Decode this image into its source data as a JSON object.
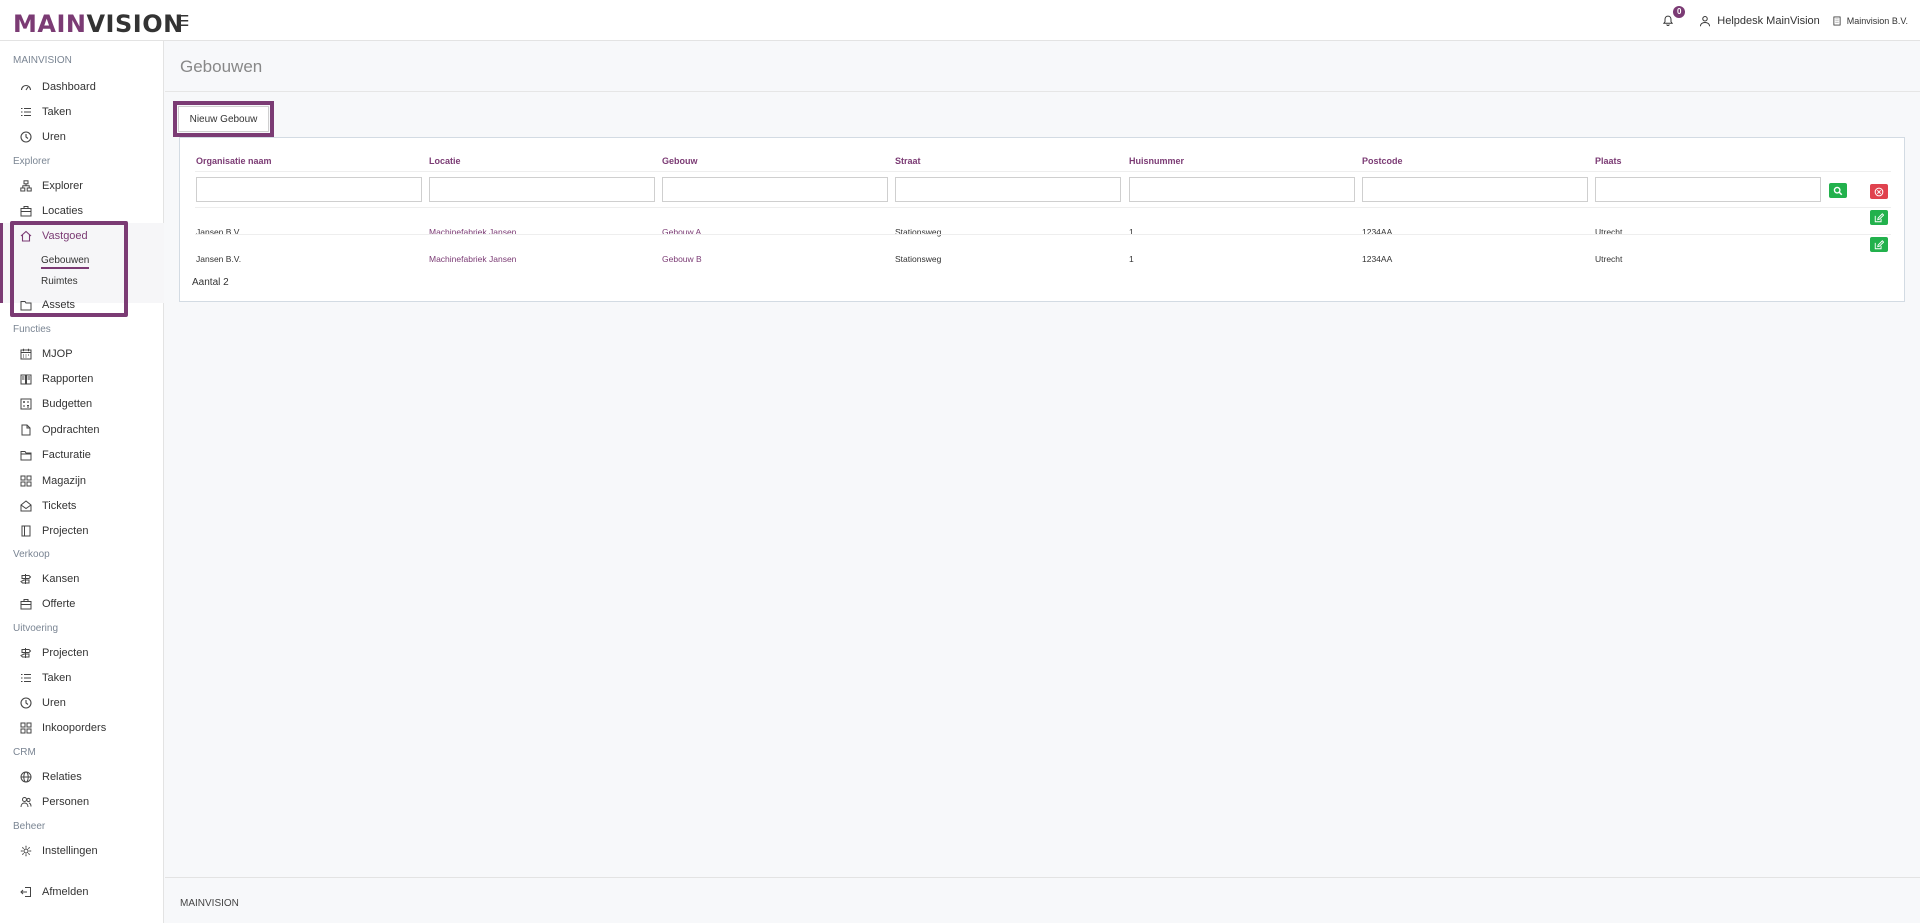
{
  "brand": {
    "main": "MAIN",
    "vision": "VISION",
    "accent": "#7b3b74"
  },
  "topbar": {
    "notification_count": "0",
    "user": "Helpdesk MainVision",
    "company": "Mainvision B.V."
  },
  "sidebar": {
    "sections": {
      "mainvision": "MAINVISION",
      "explorer": "Explorer",
      "functies": "Functies",
      "verkoop": "Verkoop",
      "uitvoering": "Uitvoering",
      "crm": "CRM",
      "beheer": "Beheer"
    },
    "items": {
      "dashboard": "Dashboard",
      "taken": "Taken",
      "uren": "Uren",
      "explorer": "Explorer",
      "locaties": "Locaties",
      "vastgoed": "Vastgoed",
      "gebouwen": "Gebouwen",
      "ruimtes": "Ruimtes",
      "assets": "Assets",
      "mjop": "MJOP",
      "rapporten": "Rapporten",
      "budgetten": "Budgetten",
      "opdrachten": "Opdrachten",
      "facturatie": "Facturatie",
      "magazijn": "Magazijn",
      "tickets": "Tickets",
      "projecten": "Projecten",
      "kansen": "Kansen",
      "offerte": "Offerte",
      "uit_projecten": "Projecten",
      "uit_taken": "Taken",
      "uit_uren": "Uren",
      "inkooporders": "Inkooporders",
      "relaties": "Relaties",
      "personen": "Personen",
      "instellingen": "Instellingen",
      "afmelden": "Afmelden"
    }
  },
  "page": {
    "title": "Gebouwen",
    "new_button": "Nieuw Gebouw"
  },
  "table": {
    "columns": [
      "Organisatie naam",
      "Locatie",
      "Gebouw",
      "Straat",
      "Huisnummer",
      "Postcode",
      "Plaats"
    ],
    "rows": [
      [
        "Jansen B.V.",
        "Machinefabriek Jansen",
        "Gebouw A",
        "Stationsweg",
        "1",
        "1234AA",
        "Utrecht"
      ],
      [
        "Jansen B.V.",
        "Machinefabriek Jansen",
        "Gebouw B",
        "Stationsweg",
        "1",
        "1234AA",
        "Utrecht"
      ]
    ],
    "count": "Aantal 2"
  },
  "footer": {
    "text": "MAINVISION"
  }
}
